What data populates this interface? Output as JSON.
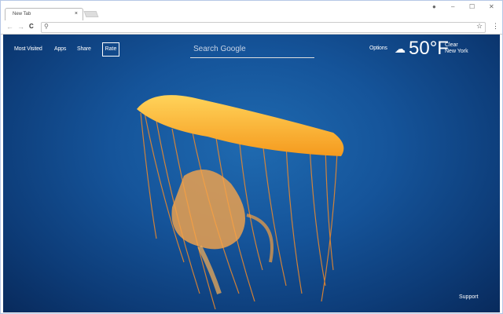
{
  "browser": {
    "tab_title": "New Tab",
    "tab_close": "×",
    "minimize": "–",
    "maximize": "☐",
    "close": "✕",
    "account_icon": "●",
    "back": "←",
    "forward": "→",
    "reload": "C",
    "search_icon": "⚲",
    "star": "☆",
    "menu": "⋮",
    "address_value": ""
  },
  "newtab": {
    "links": [
      "Most Visited",
      "Apps",
      "Share"
    ],
    "rate_label": "Rate",
    "search_placeholder": "Search Google",
    "options_label": "Options",
    "weather": {
      "temperature": "50°F",
      "condition": "Clear",
      "location": "New York"
    },
    "support_label": "Support"
  }
}
